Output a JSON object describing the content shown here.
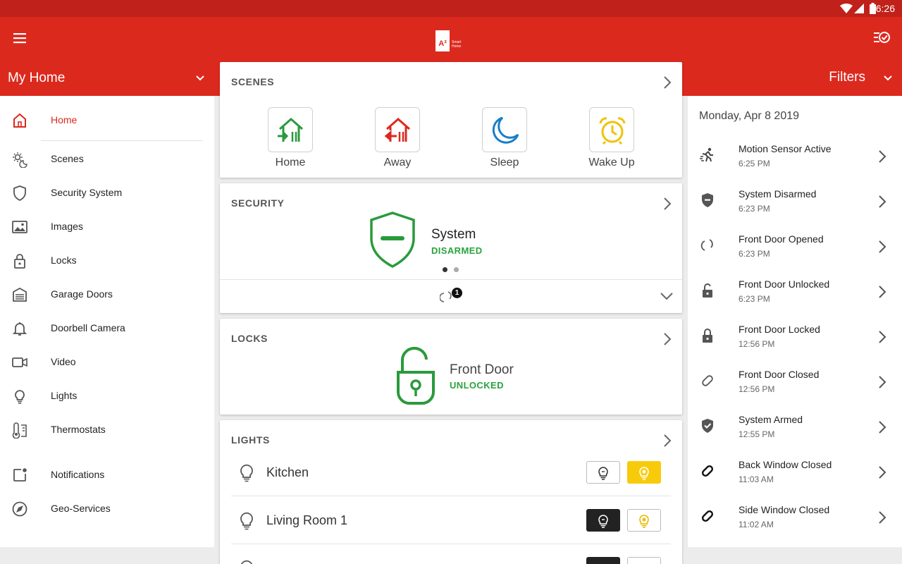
{
  "status_bar": {
    "time": "6:26"
  },
  "app": {
    "logo_mark": "A³",
    "logo_text_line1": "Smart",
    "logo_text_line2": "Home",
    "home_selector": "My Home",
    "filters_label": "Filters"
  },
  "sidebar": {
    "items": [
      {
        "label": "Home",
        "icon": "home-icon",
        "active": true
      },
      {
        "label": "Scenes",
        "icon": "scenes-icon"
      },
      {
        "label": "Security System",
        "icon": "shield-icon"
      },
      {
        "label": "Images",
        "icon": "image-icon"
      },
      {
        "label": "Locks",
        "icon": "lock-icon"
      },
      {
        "label": "Garage Doors",
        "icon": "garage-icon"
      },
      {
        "label": "Doorbell Camera",
        "icon": "bell-icon"
      },
      {
        "label": "Video",
        "icon": "video-icon"
      },
      {
        "label": "Lights",
        "icon": "bulb-icon"
      },
      {
        "label": "Thermostats",
        "icon": "thermostat-icon"
      },
      {
        "label": "Notifications",
        "icon": "notification-icon"
      },
      {
        "label": "Geo-Services",
        "icon": "compass-icon"
      }
    ]
  },
  "scenes": {
    "title": "SCENES",
    "items": [
      {
        "name": "Home",
        "icon": "scene-home-icon"
      },
      {
        "name": "Away",
        "icon": "scene-away-icon"
      },
      {
        "name": "Sleep",
        "icon": "scene-sleep-icon"
      },
      {
        "name": "Wake Up",
        "icon": "scene-wakeup-icon"
      }
    ]
  },
  "security": {
    "title": "SECURITY",
    "system_name": "System",
    "status": "DISARMED",
    "sensor_badge": "1"
  },
  "locks": {
    "title": "LOCKS",
    "lock_name": "Front Door",
    "status": "UNLOCKED"
  },
  "lights": {
    "title": "LIGHTS",
    "rows": [
      {
        "name": "Kitchen",
        "state": "on"
      },
      {
        "name": "Living Room 1",
        "state": "off"
      }
    ]
  },
  "events": {
    "date": "Monday, Apr 8 2019",
    "items": [
      {
        "title": "Motion Sensor Active",
        "time": "6:25 PM",
        "icon": "motion-icon"
      },
      {
        "title": "System Disarmed",
        "time": "6:23 PM",
        "icon": "shield-disarmed-icon"
      },
      {
        "title": "Front Door Opened",
        "time": "6:23 PM",
        "icon": "door-opened-icon"
      },
      {
        "title": "Front Door Unlocked",
        "time": "6:23 PM",
        "icon": "unlock-icon"
      },
      {
        "title": "Front Door Locked",
        "time": "12:56 PM",
        "icon": "lock-icon"
      },
      {
        "title": "Front Door Closed",
        "time": "12:56 PM",
        "icon": "door-closed-icon"
      },
      {
        "title": "System Armed",
        "time": "12:55 PM",
        "icon": "shield-armed-icon"
      },
      {
        "title": "Back Window Closed",
        "time": "11:03 AM",
        "icon": "window-closed-icon"
      },
      {
        "title": "Side Window Closed",
        "time": "11:02 AM",
        "icon": "window-closed-icon"
      }
    ]
  },
  "colors": {
    "brand_red": "#dc291e",
    "status_bar": "#c0211a",
    "ok_green": "#2aa33e",
    "light_on_yellow": "#f8cb0a"
  }
}
